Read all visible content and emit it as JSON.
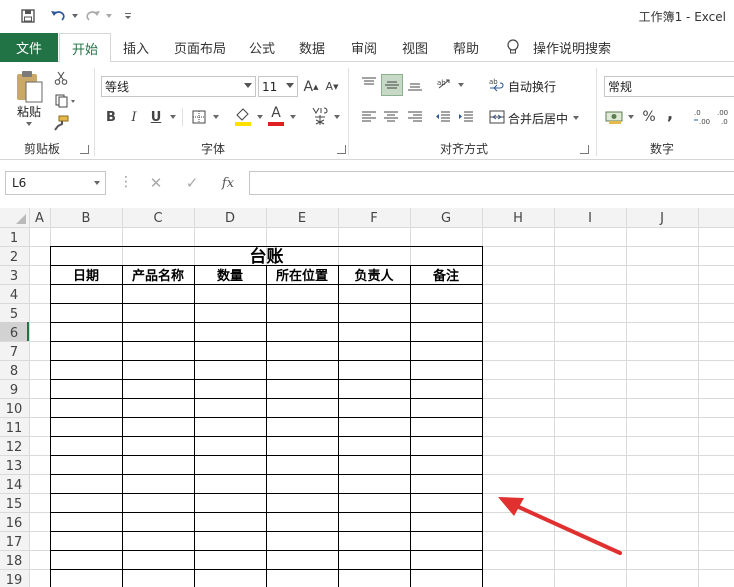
{
  "window": {
    "title": "工作簿1 - Excel"
  },
  "qat": {
    "save_icon": "save-icon",
    "undo_icon": "undo-icon",
    "redo_icon": "redo-icon",
    "customize_icon": "customize-qat-icon"
  },
  "tabs": [
    "文件",
    "开始",
    "插入",
    "页面布局",
    "公式",
    "数据",
    "审阅",
    "视图",
    "帮助"
  ],
  "tell_me": "操作说明搜索",
  "ribbon": {
    "clipboard": {
      "paste": "粘贴",
      "label": "剪贴板"
    },
    "font": {
      "name": "等线",
      "size": "11",
      "bold": "B",
      "italic": "I",
      "underline": "U",
      "label": "字体",
      "grow": "A",
      "shrink": "A",
      "font_color_letter": "A"
    },
    "alignment": {
      "wrap": "自动换行",
      "merge": "合并后居中",
      "label": "对齐方式"
    },
    "number": {
      "format": "常规",
      "percent": "%",
      "comma": ",",
      "label": "数字"
    }
  },
  "formula_bar": {
    "name_box": "L6",
    "fx": "fx",
    "content": ""
  },
  "grid": {
    "columns": [
      "A",
      "B",
      "C",
      "D",
      "E",
      "F",
      "G",
      "H",
      "I",
      "J"
    ],
    "rows": [
      "1",
      "2",
      "3",
      "4",
      "5",
      "6",
      "7",
      "8",
      "9",
      "10",
      "11",
      "12",
      "13",
      "14",
      "15",
      "16",
      "17",
      "18",
      "19"
    ],
    "selected_row": "6",
    "table_title": "台账",
    "headers": [
      "日期",
      "产品名称",
      "数量",
      "所在位置",
      "负责人",
      "备注"
    ]
  },
  "colors": {
    "excel_green": "#217346",
    "red_arrow": "#e03030",
    "font_color": "#e02020",
    "fill_color": "#ffe000"
  }
}
